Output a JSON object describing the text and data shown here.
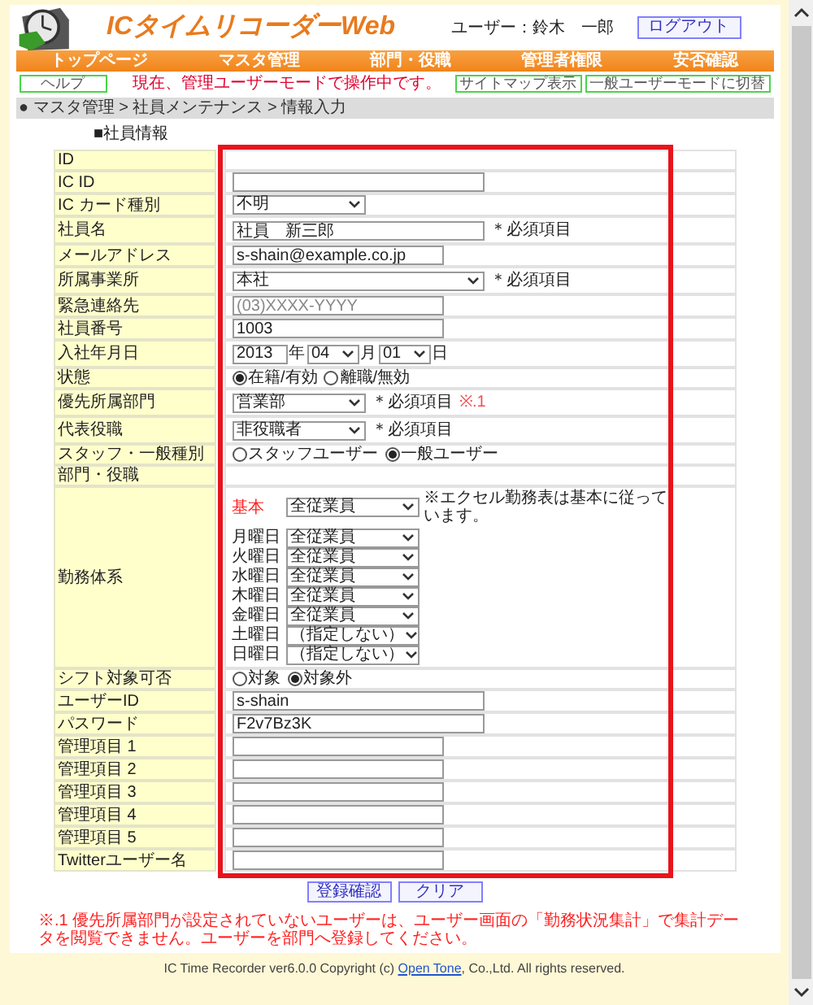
{
  "header": {
    "title": "ICタイムリコーダーWeb",
    "user": "ユーザー：鈴木　一郎",
    "logout": "ログアウト"
  },
  "nav": [
    "トップページ",
    "マスタ管理",
    "部門・役職",
    "管理者権限",
    "安否確認"
  ],
  "toolbar": {
    "help": "ヘルプ",
    "notice": "現在、管理ユーザーモードで操作中です。",
    "sitemap": "サイトマップ表示",
    "switch_mode": "一般ユーザーモードに切替"
  },
  "breadcrumb": "● マスタ管理 > 社員メンテナンス > 情報入力",
  "section_title": "■社員情報",
  "rows": [
    {
      "label": "ID",
      "kind": "empty"
    },
    {
      "label": "IC ID",
      "kind": "wide-input"
    },
    {
      "label": "IC カード種別",
      "kind": "select",
      "value": "不明"
    },
    {
      "label": "社員名",
      "kind": "wide-input",
      "value": "社員　新三郎",
      "note": "＊必須項目"
    },
    {
      "label": "メールアドレス",
      "kind": "input",
      "value": "s-shain@example.co.jp"
    },
    {
      "label": "所属事業所",
      "kind": "wide-select",
      "value": "本社",
      "note": "＊必須項目"
    },
    {
      "label": "緊急連絡先",
      "kind": "input",
      "placeholder": "(03)XXXX-YYYY"
    },
    {
      "label": "社員番号",
      "kind": "input",
      "value": "1003"
    },
    {
      "label": "入社年月日",
      "kind": "date",
      "year": "2013",
      "year_unit": "年",
      "month": "04",
      "month_unit": "月",
      "day": "01",
      "day_unit": "日"
    },
    {
      "label": "状態",
      "kind": "radio",
      "options": [
        {
          "label": "在籍/有効",
          "selected": true
        },
        {
          "label": "離職/無効",
          "selected": false
        }
      ]
    },
    {
      "label": "優先所属部門",
      "kind": "select",
      "value": "営業部",
      "note": "＊必須項目",
      "footnote": "※.1"
    },
    {
      "label": "代表役職",
      "kind": "select",
      "value": "非役職者",
      "note": "＊必須項目"
    },
    {
      "label": "スタッフ・一般種別",
      "kind": "radio",
      "options": [
        {
          "label": "スタッフユーザー",
          "selected": false
        },
        {
          "label": "一般ユーザー",
          "selected": true
        }
      ]
    },
    {
      "label": "部門・役職",
      "kind": "empty"
    },
    {
      "label": "勤務体系",
      "kind": "schedule",
      "base_label": "基本",
      "base_value": "全従業員",
      "note": "※エクセル勤務表は基本に従っています。",
      "days": [
        {
          "label": "月曜日",
          "value": "全従業員"
        },
        {
          "label": "火曜日",
          "value": "全従業員"
        },
        {
          "label": "水曜日",
          "value": "全従業員"
        },
        {
          "label": "木曜日",
          "value": "全従業員"
        },
        {
          "label": "金曜日",
          "value": "全従業員"
        },
        {
          "label": "土曜日",
          "value": "（指定しない）"
        },
        {
          "label": "日曜日",
          "value": "（指定しない）"
        }
      ]
    },
    {
      "label": "シフト対象可否",
      "kind": "radio",
      "options": [
        {
          "label": "対象",
          "selected": false
        },
        {
          "label": "対象外",
          "selected": true
        }
      ]
    },
    {
      "label": "ユーザーID",
      "kind": "wide-input",
      "value": "s-shain"
    },
    {
      "label": "パスワード",
      "kind": "wide-input",
      "value": "F2v7Bz3K"
    },
    {
      "label": "管理項目 1",
      "kind": "input"
    },
    {
      "label": "管理項目 2",
      "kind": "input"
    },
    {
      "label": "管理項目 3",
      "kind": "input"
    },
    {
      "label": "管理項目 4",
      "kind": "input"
    },
    {
      "label": "管理項目 5",
      "kind": "input"
    },
    {
      "label": "Twitterユーザー名",
      "kind": "input"
    }
  ],
  "buttons": [
    "登録確認",
    "クリア"
  ],
  "footnote": "※.1 優先所属部門が設定されていないユーザーは、ユーザー画面の「勤務状況集計」で集計データを閲覧できません。ユーザーを部門へ登録してください。",
  "footer": {
    "before": "IC Time Recorder ver6.0.0 Copyright (c) ",
    "link": "Open Tone",
    "after": ", Co.,Ltd. All rights reserved."
  }
}
